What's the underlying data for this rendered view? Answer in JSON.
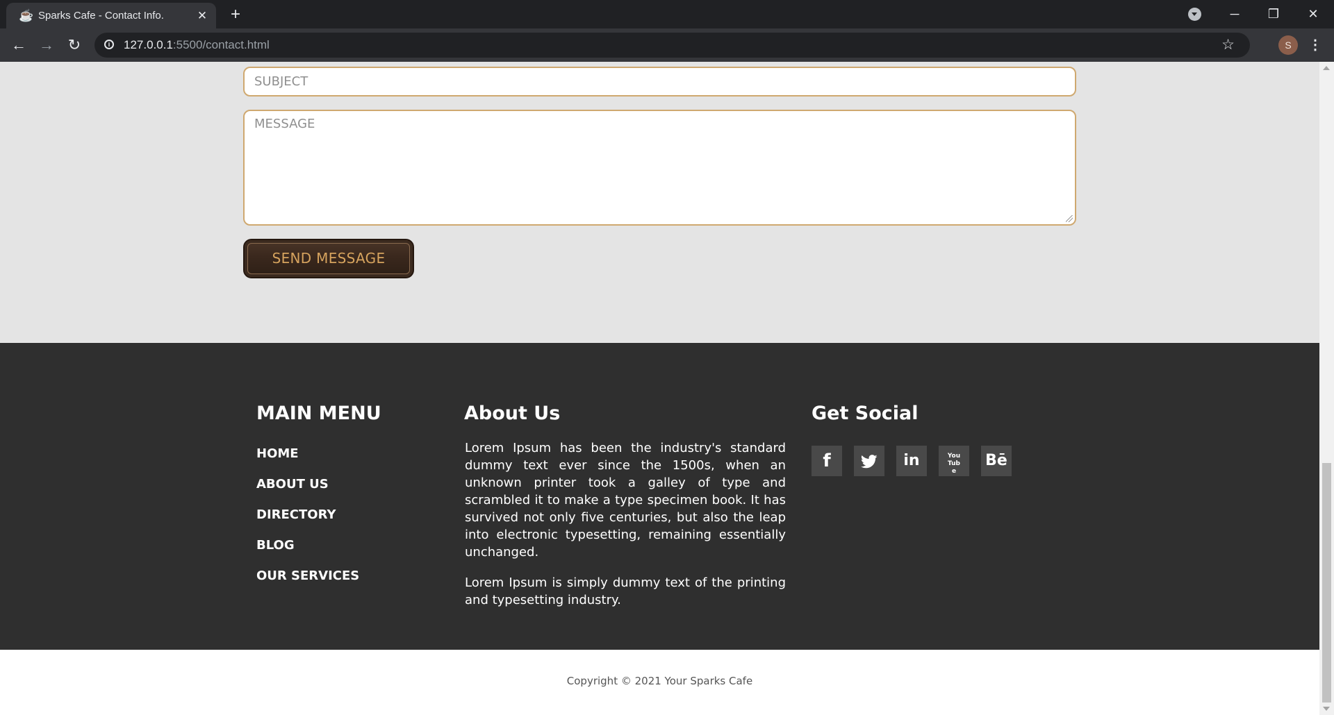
{
  "browser": {
    "tab_title": "Sparks Cafe - Contact Info.",
    "tab_icon": "coffee-cup-icon",
    "url_host": "127.0.0.1",
    "url_rest": ":5500/contact.html",
    "profile_initial": "S"
  },
  "contact_form": {
    "subject_placeholder": "SUBJECT",
    "message_placeholder": "MESSAGE",
    "send_label": "SEND MESSAGE"
  },
  "footer": {
    "main_menu": {
      "title": "MAIN MENU",
      "items": [
        {
          "label": "HOME"
        },
        {
          "label": "ABOUT US"
        },
        {
          "label": "DIRECTORY"
        },
        {
          "label": "BLOG"
        },
        {
          "label": "OUR SERVICES"
        }
      ]
    },
    "about": {
      "title": "About Us",
      "paragraphs": [
        "Lorem Ipsum has been the industry's standard dummy text ever since the 1500s, when an unknown printer took a galley of type and scrambled it to make a type specimen book. It has survived not only five centuries, but also the leap into electronic typesetting, remaining essentially unchanged.",
        "Lorem Ipsum is simply dummy text of the printing and typesetting industry."
      ]
    },
    "social": {
      "title": "Get Social",
      "icons": [
        {
          "name": "facebook-icon",
          "glyph": "f"
        },
        {
          "name": "twitter-icon",
          "glyph": "🐦"
        },
        {
          "name": "linkedin-icon",
          "glyph": "in"
        },
        {
          "name": "youtube-icon",
          "glyph": "You Tube"
        },
        {
          "name": "behance-icon",
          "glyph": "Bē"
        }
      ]
    }
  },
  "copyright": "Copyright © 2021 Your Sparks Cafe",
  "colors": {
    "accent": "#d6a35e",
    "footer_bg": "#2f2f2f",
    "page_bg": "#e4e4e4",
    "field_border": "#cfa86f"
  }
}
